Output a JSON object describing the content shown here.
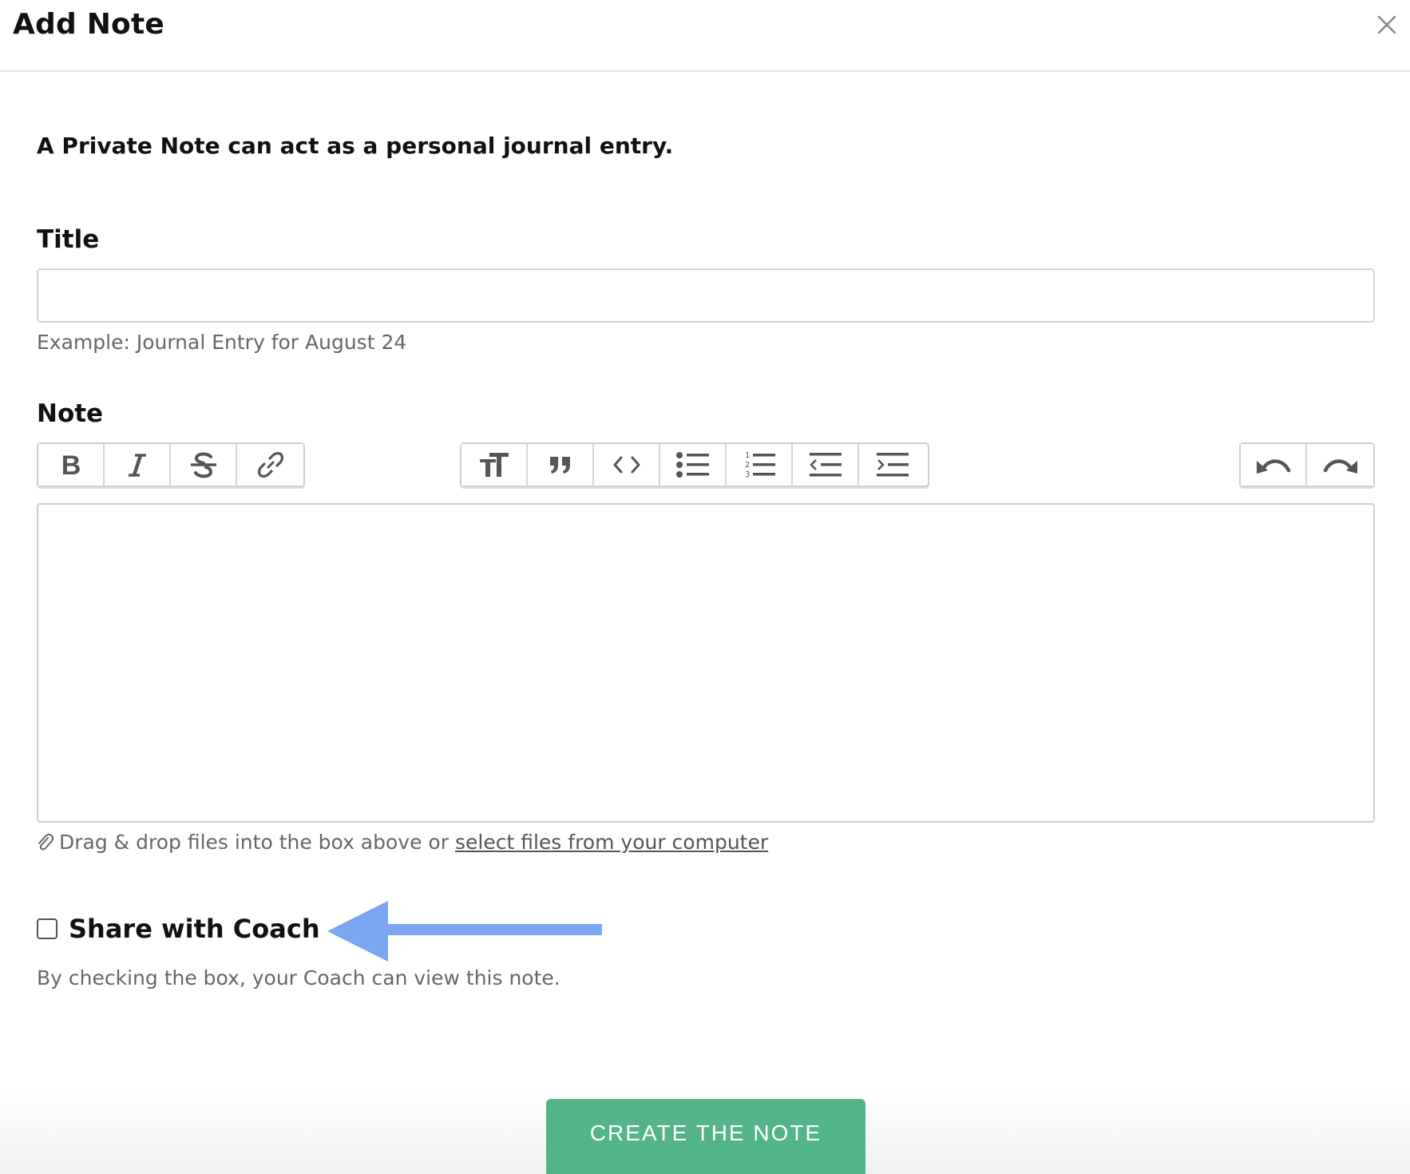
{
  "header": {
    "title": "Add Note",
    "close_icon": "close-icon"
  },
  "intro": {
    "text": "A Private Note can act as a personal journal entry."
  },
  "title_field": {
    "label": "Title",
    "value": "",
    "placeholder": "",
    "hint": "Example: Journal Entry for August 24"
  },
  "note_field": {
    "label": "Note",
    "value": ""
  },
  "toolbar": {
    "text_group": [
      "bold-icon",
      "italic-icon",
      "strikethrough-icon",
      "link-icon"
    ],
    "block_group": [
      "heading-icon",
      "quote-icon",
      "code-icon",
      "bullet-list-icon",
      "numbered-list-icon",
      "outdent-icon",
      "indent-icon"
    ],
    "history_group": [
      "undo-icon",
      "redo-icon"
    ]
  },
  "attachments": {
    "prefix_text": "Drag & drop files into the box above or",
    "link_text": "select files from your computer",
    "icon": "paperclip-icon"
  },
  "share": {
    "label": "Share with Coach",
    "checked": false,
    "hint": "By checking the box, your Coach can view this note.",
    "annotation_color": "#7aa6f2"
  },
  "footer": {
    "create_label": "CREATE THE NOTE",
    "button_color": "#53b48a"
  }
}
